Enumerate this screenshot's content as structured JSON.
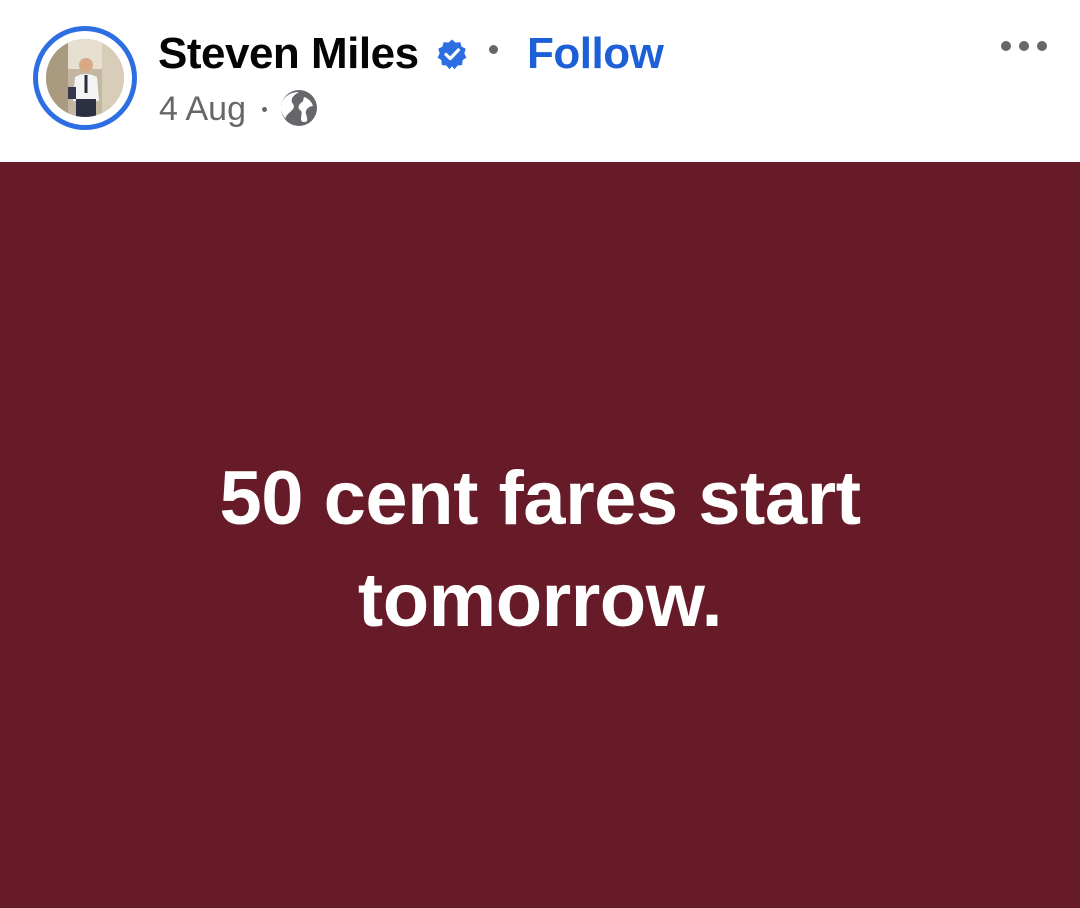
{
  "post": {
    "author": "Steven Miles",
    "follow_label": "Follow",
    "date": "4 Aug",
    "audience_icon": "globe-icon",
    "verified_icon": "verified-badge-icon",
    "more_icon": "more-options-icon",
    "content_text": "50 cent fares start tomorrow."
  },
  "colors": {
    "banner_background": "#671b28",
    "follow_link": "#1d5fd6",
    "verified_badge": "#2d6fe3",
    "secondary_text": "#65676b"
  }
}
